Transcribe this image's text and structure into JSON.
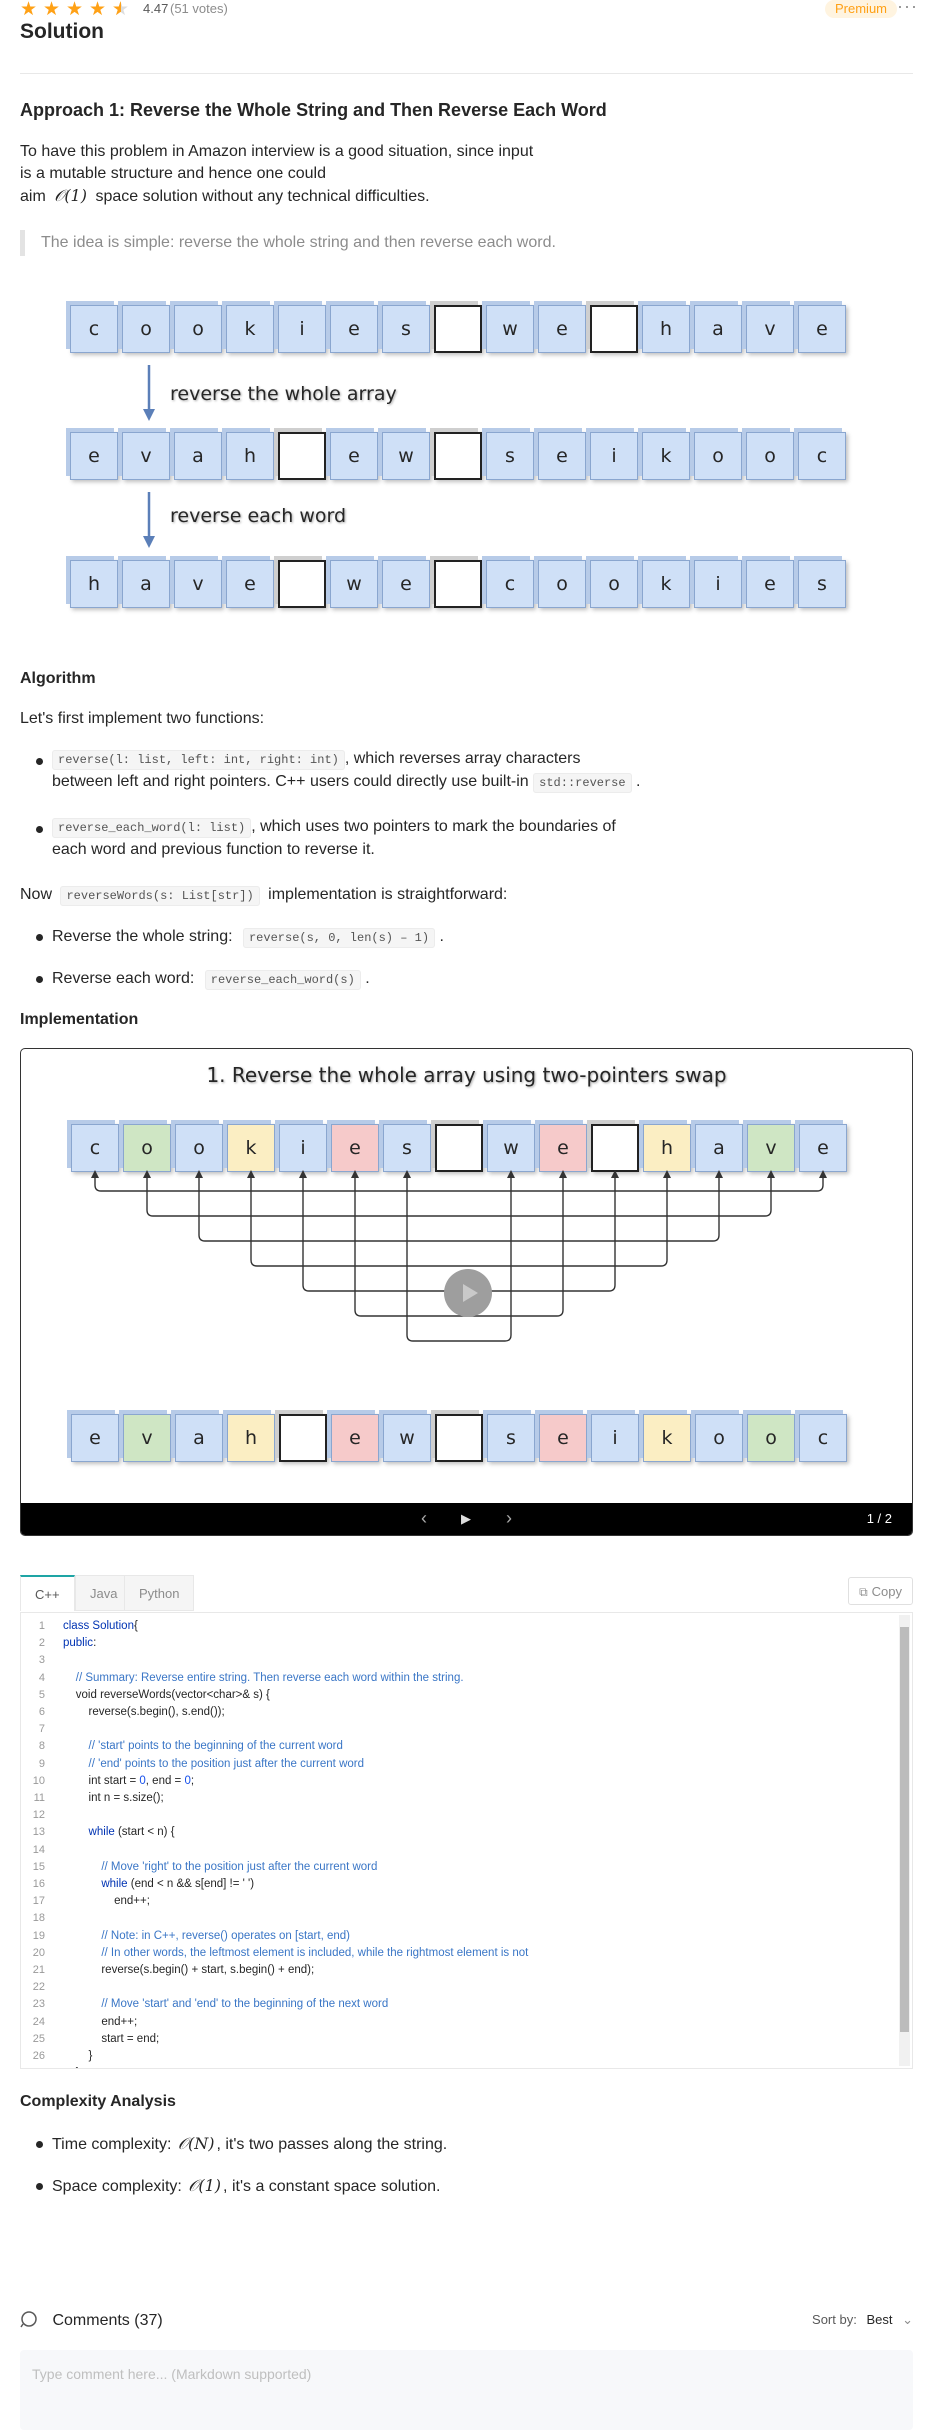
{
  "rating": {
    "score": "4.47",
    "votes": "(51 votes)"
  },
  "premium": "Premium",
  "more": "···",
  "page_title": "Solution",
  "approach_title": "Approach 1: Reverse the Whole String and Then Reverse Each Word",
  "intro": {
    "line1": "To have this problem in Amazon interview is a good situation, since input",
    "line2": "is a mutable structure and hence one could",
    "line3_pre": "aim",
    "line3_math": "𝒪(1)",
    "line3_post": "space solution without any technical difficulties."
  },
  "quote": "The idea is simple: reverse the whole string and then reverse each word.",
  "diagram1": {
    "row1": [
      "c",
      "o",
      "o",
      "k",
      "i",
      "e",
      "s",
      " ",
      "w",
      "e",
      " ",
      "h",
      "a",
      "v",
      "e"
    ],
    "row2": [
      "e",
      "v",
      "a",
      "h",
      " ",
      "e",
      "w",
      " ",
      "s",
      "e",
      "i",
      "k",
      "o",
      "o",
      "c"
    ],
    "row3": [
      "h",
      "a",
      "v",
      "e",
      " ",
      "w",
      "e",
      " ",
      "c",
      "o",
      "o",
      "k",
      "i",
      "e",
      "s"
    ],
    "arrow1_label": "reverse the whole array",
    "arrow2_label": "reverse each word"
  },
  "algorithm": {
    "title": "Algorithm",
    "intro": "Let's first implement two functions:",
    "b1_code": "reverse(l: list, left: int, right: int)",
    "b1_text1": ", which reverses array characters",
    "b1_text2": "between left and right pointers. C++ users could directly use built-in",
    "b1_code2": "std::reverse",
    "b1_end": ".",
    "b2_code": "reverse_each_word(l: list)",
    "b2_text1": ", which uses two pointers to mark the boundaries of",
    "b2_text2": "each word and previous function to reverse it.",
    "now_pre": "Now",
    "now_code": "reverseWords(s: List[str])",
    "now_post": "implementation is straightforward:",
    "s1_text": "Reverse the whole string:",
    "s1_code": "reverse(s, 0, len(s) – 1)",
    "s1_end": ".",
    "s2_text": "Reverse each word:",
    "s2_code": "reverse_each_word(s)",
    "s2_end": "."
  },
  "implementation": {
    "title": "Implementation",
    "slide_title": "1. Reverse the whole array using two-pointers swap",
    "slide_counter": "1 / 2",
    "row_top": [
      "c",
      "o",
      "o",
      "k",
      "i",
      "e",
      "s",
      " ",
      "w",
      "e",
      " ",
      "h",
      "a",
      "v",
      "e"
    ],
    "row_bottom": [
      "e",
      "v",
      "a",
      "h",
      " ",
      "e",
      "w",
      " ",
      "s",
      "e",
      "i",
      "k",
      "o",
      "o",
      "c"
    ],
    "prev_icon": "‹",
    "play_icon": "▶",
    "next_icon": "›"
  },
  "code_tabs": [
    "C++",
    "Java",
    "Python"
  ],
  "copy_label": "Copy",
  "code_lines": [
    [
      [
        "kw",
        "class "
      ],
      [
        "kw",
        "Solution"
      ],
      [
        "",
        "{"
      ]
    ],
    [
      [
        "kw",
        "public"
      ],
      [
        "",
        ":"
      ]
    ],
    [
      [
        "",
        ""
      ]
    ],
    [
      [
        "cm",
        "    // Summary: Reverse entire string. Then reverse each word within the string."
      ]
    ],
    [
      [
        "",
        "    void reverseWords(vector<char>& s) {"
      ]
    ],
    [
      [
        "",
        "        reverse(s.begin(), s.end());"
      ]
    ],
    [
      [
        "",
        ""
      ]
    ],
    [
      [
        "cm",
        "        // 'start' points to the beginning of the current word"
      ]
    ],
    [
      [
        "cm",
        "        // 'end' points to the position just after the current word"
      ]
    ],
    [
      [
        "",
        "        int start = "
      ],
      [
        "num",
        "0"
      ],
      [
        "",
        ", end = "
      ],
      [
        "num",
        "0"
      ],
      [
        "",
        ";"
      ]
    ],
    [
      [
        "",
        "        int n = s.size();"
      ]
    ],
    [
      [
        "",
        ""
      ]
    ],
    [
      [
        "kw",
        "        while"
      ],
      [
        "",
        " (start < n) {"
      ]
    ],
    [
      [
        "",
        ""
      ]
    ],
    [
      [
        "cm",
        "            // Move 'right' to the position just after the current word"
      ]
    ],
    [
      [
        "kw",
        "            while"
      ],
      [
        "",
        " (end < n && s[end] != ' ')"
      ]
    ],
    [
      [
        "",
        "                end++;"
      ]
    ],
    [
      [
        "",
        ""
      ]
    ],
    [
      [
        "cm",
        "            // Note: in C++, reverse() operates on [start, end)"
      ]
    ],
    [
      [
        "cm",
        "            // In other words, the leftmost element is included, while the rightmost element is not"
      ]
    ],
    [
      [
        "",
        "            reverse(s.begin() + start, s.begin() + end);"
      ]
    ],
    [
      [
        "",
        ""
      ]
    ],
    [
      [
        "cm",
        "            // Move 'start' and 'end' to the beginning of the next word"
      ]
    ],
    [
      [
        "",
        "            end++;"
      ]
    ],
    [
      [
        "",
        "            start = end;"
      ]
    ],
    [
      [
        "",
        "        }"
      ]
    ],
    [
      [
        "",
        "    }"
      ]
    ]
  ],
  "complexity": {
    "title": "Complexity Analysis",
    "time_pre": "Time complexity:",
    "time_math": "𝒪(N)",
    "time_post": ", it's two passes along the string.",
    "space_pre": "Space complexity:",
    "space_math": "𝒪(1)",
    "space_post": ", it's a constant space solution."
  },
  "comments": {
    "label": "Comments (37)",
    "sort_label": "Sort by:",
    "sort_value": "Best",
    "placeholder": "Type comment here... (Markdown supported)"
  },
  "colors": {
    "blue_cell": "#cfe0f7",
    "green_cell": "#cfe6c4",
    "yellow_cell": "#fbeec3",
    "red_cell": "#f6caca",
    "accent": "#ffa116"
  }
}
